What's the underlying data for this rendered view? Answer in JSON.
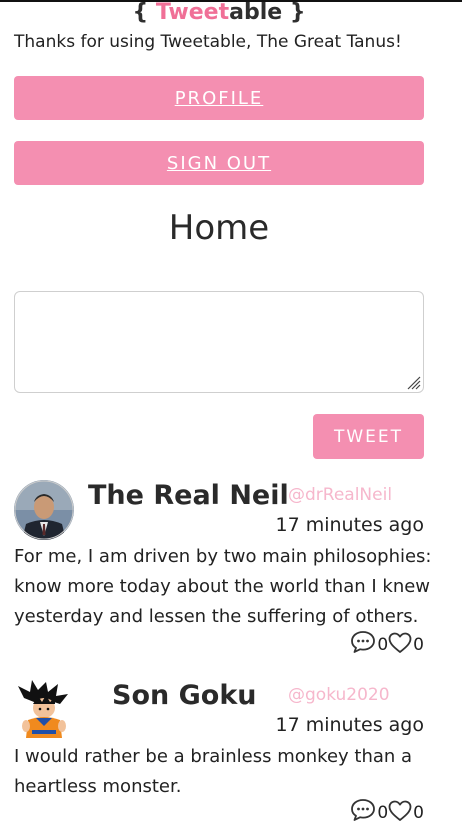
{
  "app": {
    "logo_open": "{ ",
    "logo_pink": "Tweet",
    "logo_dark": "able",
    "logo_close": " }",
    "greeting": "Thanks for using Tweetable, The Great Tanus!"
  },
  "nav": {
    "profile_label": "PROFILE",
    "sign_out_label": "SIGN OUT"
  },
  "main": {
    "heading": "Home",
    "composer_value": "",
    "tweet_button_label": "TWEET"
  },
  "tweets": [
    {
      "author": "The Real Neil",
      "handle": "@drRealNeil",
      "time": "17 minutes ago",
      "text": "For me, I am driven by two main philosophies: know more today about the world than I knew yesterday and lessen the suffering of others.",
      "comments": "0",
      "likes": "0",
      "avatar_icon": "person-portrait-icon"
    },
    {
      "author": "Son Goku",
      "handle": "@goku2020",
      "time": "17 minutes ago",
      "text": "I would rather be a brainless monkey than a heartless monster.",
      "comments": "0",
      "likes": "0",
      "avatar_icon": "cartoon-character-icon"
    }
  ],
  "colors": {
    "accent": "#f48fb1",
    "logo_pink": "#f07097",
    "handle": "#f6b7cc",
    "text": "#222222"
  }
}
